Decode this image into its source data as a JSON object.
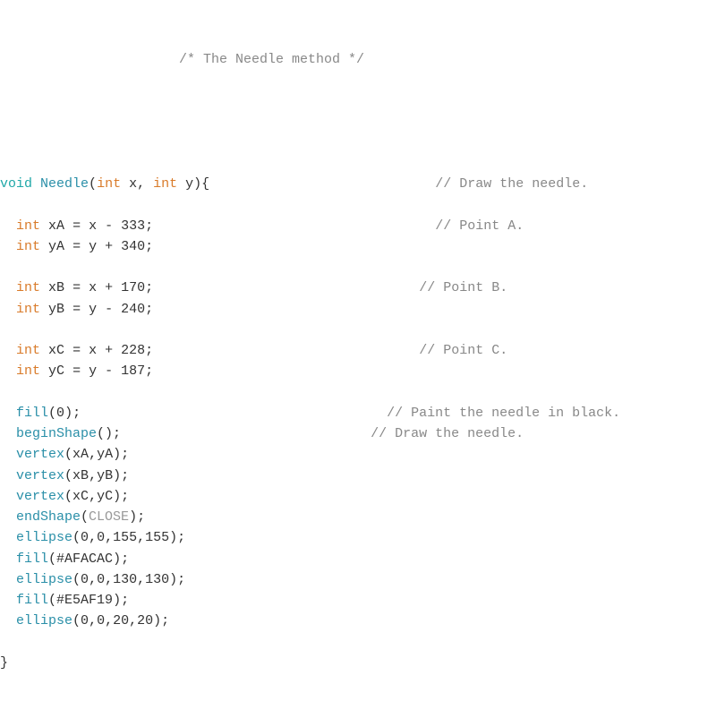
{
  "code": {
    "header_comment": "/* The Needle method */",
    "lines": [
      {
        "indent": 0,
        "tokens": [
          [
            "kw-type",
            "void"
          ],
          [
            "sp",
            " "
          ],
          [
            "func",
            "Needle"
          ],
          [
            "punct",
            "("
          ],
          [
            "kw-type2",
            "int"
          ],
          [
            "sp",
            " "
          ],
          [
            "ident",
            "x"
          ],
          [
            "punct",
            ", "
          ],
          [
            "kw-type2",
            "int"
          ],
          [
            "sp",
            " "
          ],
          [
            "ident",
            "y"
          ],
          [
            "punct",
            "){"
          ]
        ],
        "comment": "// Draw the needle.",
        "comment_col": 54
      },
      {
        "blank": true
      },
      {
        "indent": 2,
        "tokens": [
          [
            "kw-type2",
            "int"
          ],
          [
            "sp",
            " "
          ],
          [
            "ident",
            "xA"
          ],
          [
            "op",
            " = "
          ],
          [
            "ident",
            "x"
          ],
          [
            "op",
            " - "
          ],
          [
            "num",
            "333"
          ],
          [
            "punct",
            ";"
          ]
        ],
        "comment": "// Point A.",
        "comment_col": 54
      },
      {
        "indent": 2,
        "tokens": [
          [
            "kw-type2",
            "int"
          ],
          [
            "sp",
            " "
          ],
          [
            "ident",
            "yA"
          ],
          [
            "op",
            " = "
          ],
          [
            "ident",
            "y"
          ],
          [
            "op",
            " + "
          ],
          [
            "num",
            "340"
          ],
          [
            "punct",
            ";"
          ]
        ]
      },
      {
        "blank": true
      },
      {
        "indent": 2,
        "tokens": [
          [
            "kw-type2",
            "int"
          ],
          [
            "sp",
            " "
          ],
          [
            "ident",
            "xB"
          ],
          [
            "op",
            " = "
          ],
          [
            "ident",
            "x"
          ],
          [
            "op",
            " + "
          ],
          [
            "num",
            "170"
          ],
          [
            "punct",
            ";"
          ]
        ],
        "comment": "// Point B.",
        "comment_col": 52
      },
      {
        "indent": 2,
        "tokens": [
          [
            "kw-type2",
            "int"
          ],
          [
            "sp",
            " "
          ],
          [
            "ident",
            "yB"
          ],
          [
            "op",
            " = "
          ],
          [
            "ident",
            "y"
          ],
          [
            "op",
            " - "
          ],
          [
            "num",
            "240"
          ],
          [
            "punct",
            ";"
          ]
        ]
      },
      {
        "blank": true
      },
      {
        "indent": 2,
        "tokens": [
          [
            "kw-type2",
            "int"
          ],
          [
            "sp",
            " "
          ],
          [
            "ident",
            "xC"
          ],
          [
            "op",
            " = "
          ],
          [
            "ident",
            "x"
          ],
          [
            "op",
            " + "
          ],
          [
            "num",
            "228"
          ],
          [
            "punct",
            ";"
          ]
        ],
        "comment": "// Point C.",
        "comment_col": 52
      },
      {
        "indent": 2,
        "tokens": [
          [
            "kw-type2",
            "int"
          ],
          [
            "sp",
            " "
          ],
          [
            "ident",
            "yC"
          ],
          [
            "op",
            " = "
          ],
          [
            "ident",
            "y"
          ],
          [
            "op",
            " - "
          ],
          [
            "num",
            "187"
          ],
          [
            "punct",
            ";"
          ]
        ]
      },
      {
        "blank": true
      },
      {
        "indent": 2,
        "tokens": [
          [
            "func",
            "fill"
          ],
          [
            "punct",
            "("
          ],
          [
            "num",
            "0"
          ],
          [
            "punct",
            ");"
          ]
        ],
        "comment": "// Paint the needle in black.",
        "comment_col": 48
      },
      {
        "indent": 2,
        "tokens": [
          [
            "func",
            "beginShape"
          ],
          [
            "punct",
            "();"
          ]
        ],
        "comment": "// Draw the needle.",
        "comment_col": 46
      },
      {
        "indent": 2,
        "tokens": [
          [
            "func",
            "vertex"
          ],
          [
            "punct",
            "("
          ],
          [
            "ident",
            "xA"
          ],
          [
            "punct",
            ","
          ],
          [
            "ident",
            "yA"
          ],
          [
            "punct",
            ");"
          ]
        ]
      },
      {
        "indent": 2,
        "tokens": [
          [
            "func",
            "vertex"
          ],
          [
            "punct",
            "("
          ],
          [
            "ident",
            "xB"
          ],
          [
            "punct",
            ","
          ],
          [
            "ident",
            "yB"
          ],
          [
            "punct",
            ");"
          ]
        ]
      },
      {
        "indent": 2,
        "tokens": [
          [
            "func",
            "vertex"
          ],
          [
            "punct",
            "("
          ],
          [
            "ident",
            "xC"
          ],
          [
            "punct",
            ","
          ],
          [
            "ident",
            "yC"
          ],
          [
            "punct",
            ");"
          ]
        ]
      },
      {
        "indent": 2,
        "tokens": [
          [
            "func",
            "endShape"
          ],
          [
            "punct",
            "("
          ],
          [
            "const",
            "CLOSE"
          ],
          [
            "punct",
            ");"
          ]
        ]
      },
      {
        "indent": 2,
        "tokens": [
          [
            "func",
            "ellipse"
          ],
          [
            "punct",
            "("
          ],
          [
            "num",
            "0"
          ],
          [
            "punct",
            ","
          ],
          [
            "num",
            "0"
          ],
          [
            "punct",
            ","
          ],
          [
            "num",
            "155"
          ],
          [
            "punct",
            ","
          ],
          [
            "num",
            "155"
          ],
          [
            "punct",
            ");"
          ]
        ]
      },
      {
        "indent": 2,
        "tokens": [
          [
            "func",
            "fill"
          ],
          [
            "punct",
            "("
          ],
          [
            "hex",
            "#AFACAC"
          ],
          [
            "punct",
            ");"
          ]
        ]
      },
      {
        "indent": 2,
        "tokens": [
          [
            "func",
            "ellipse"
          ],
          [
            "punct",
            "("
          ],
          [
            "num",
            "0"
          ],
          [
            "punct",
            ","
          ],
          [
            "num",
            "0"
          ],
          [
            "punct",
            ","
          ],
          [
            "num",
            "130"
          ],
          [
            "punct",
            ","
          ],
          [
            "num",
            "130"
          ],
          [
            "punct",
            ");"
          ]
        ]
      },
      {
        "indent": 2,
        "tokens": [
          [
            "func",
            "fill"
          ],
          [
            "punct",
            "("
          ],
          [
            "hex",
            "#E5AF19"
          ],
          [
            "punct",
            ");"
          ]
        ]
      },
      {
        "indent": 2,
        "tokens": [
          [
            "func",
            "ellipse"
          ],
          [
            "punct",
            "("
          ],
          [
            "num",
            "0"
          ],
          [
            "punct",
            ","
          ],
          [
            "num",
            "0"
          ],
          [
            "punct",
            ","
          ],
          [
            "num",
            "20"
          ],
          [
            "punct",
            ","
          ],
          [
            "num",
            "20"
          ],
          [
            "punct",
            ");"
          ]
        ]
      },
      {
        "blank": true
      },
      {
        "indent": 0,
        "tokens": [
          [
            "punct",
            "}"
          ]
        ]
      }
    ]
  }
}
